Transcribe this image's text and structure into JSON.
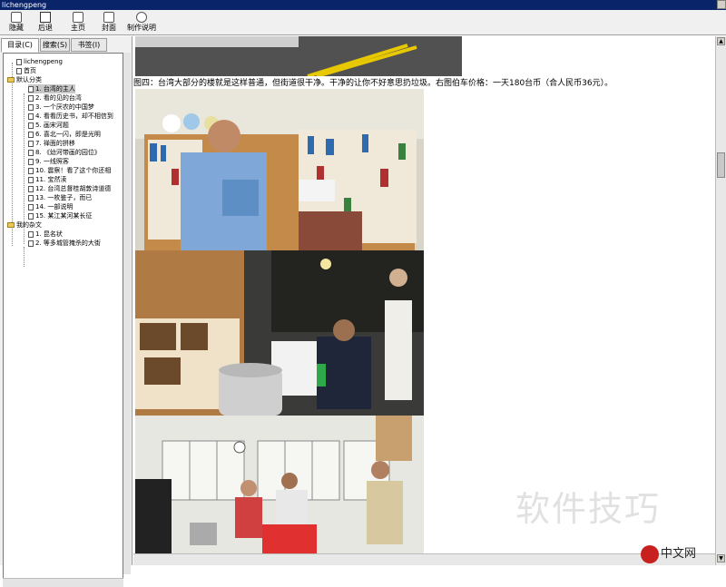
{
  "window": {
    "title": "lichengpeng"
  },
  "toolbar": {
    "buttons": [
      {
        "label": "隐藏"
      },
      {
        "label": "后退"
      },
      {
        "label": "主页"
      },
      {
        "label": "封面"
      },
      {
        "label": "制作说明"
      }
    ]
  },
  "sidebar": {
    "tabs": [
      {
        "label": "目录(C)"
      },
      {
        "label": "搜索(S)"
      },
      {
        "label": "书签(I)"
      }
    ],
    "tree": [
      {
        "label": "lichengpeng"
      },
      {
        "label": "首页"
      },
      {
        "label": "默认分类"
      },
      {
        "label": "1. 台湾的主人"
      },
      {
        "label": "2. 看的见的台湾"
      },
      {
        "label": "3. 一个厌农的中国梦"
      },
      {
        "label": "4. 看看历史书，却不相信到"
      },
      {
        "label": "5. 画宋河题"
      },
      {
        "label": "6. 喜北一闪，即是光明"
      },
      {
        "label": "7. 禅面的拼移"
      },
      {
        "label": "8. 《幼河带画的园位》"
      },
      {
        "label": "9. 一线照客"
      },
      {
        "label": "10. 震察！看了这个你还相"
      },
      {
        "label": "11. 宝然渎"
      },
      {
        "label": "12. 台湾总督桂胡敦诗道德"
      },
      {
        "label": "13. 一枚鉴子，而已"
      },
      {
        "label": "14. 一部说明"
      },
      {
        "label": "15. 某江某河某长征"
      },
      {
        "label": "我的杂文"
      },
      {
        "label": "1. 昆名状"
      },
      {
        "label": "2. 等多城管掩杀的大街"
      }
    ]
  },
  "content": {
    "caption": "图四：台湾大部分的楼就是这样普通，但街道很干净。干净的让你不好意思扔垃圾。右图伯车价格：一天180台币（合人民币36元）。"
  },
  "overlay": {
    "watermark": "软件技巧",
    "badge": "中文网",
    "badge_logo": "php"
  }
}
